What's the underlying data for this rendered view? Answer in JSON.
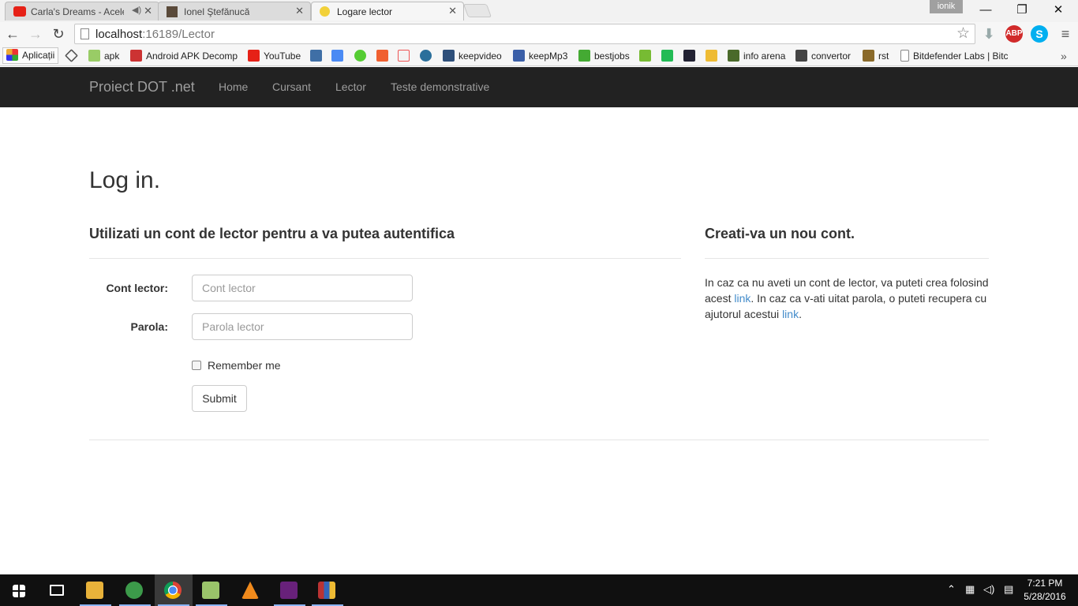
{
  "browser": {
    "tabs": [
      {
        "title": "Carla's Dreams - Acele",
        "favicon": "youtube-icon"
      },
      {
        "title": "Ionel Ştefănucă",
        "favicon": "avatar-icon"
      },
      {
        "title": "Logare lector",
        "favicon": "bulb-icon"
      }
    ],
    "user_badge": "ionik",
    "url_host": "localhost",
    "url_rest": ":16189/Lector",
    "bookmarks": [
      {
        "label": "Aplicații",
        "icon": "apps-grid-icon"
      },
      {
        "label": "",
        "icon": "diamond-icon"
      },
      {
        "label": "apk",
        "icon": "android-icon"
      },
      {
        "label": "Android APK Decomp",
        "icon": "robot-icon"
      },
      {
        "label": "YouTube",
        "icon": "youtube-icon"
      },
      {
        "label": "",
        "icon": "tz-icon"
      },
      {
        "label": "",
        "icon": "translate-icon"
      },
      {
        "label": "",
        "icon": "green-ball-icon"
      },
      {
        "label": "",
        "icon": "plus-icon"
      },
      {
        "label": "",
        "icon": "eb-icon"
      },
      {
        "label": "",
        "icon": "blue-drop-icon"
      },
      {
        "label": "keepvideo",
        "icon": "kv-icon"
      },
      {
        "label": "keepMp3",
        "icon": "mp3-icon"
      },
      {
        "label": "bestjobs",
        "icon": "star-green-icon"
      },
      {
        "label": "",
        "icon": "android-green-icon"
      },
      {
        "label": "",
        "icon": "u-icon"
      },
      {
        "label": "",
        "icon": "mt-icon"
      },
      {
        "label": "",
        "icon": "star-yellow-icon"
      },
      {
        "label": "info arena",
        "icon": "dino-icon"
      },
      {
        "label": "convertor",
        "icon": "binary-icon"
      },
      {
        "label": "rst",
        "icon": "rst-icon"
      },
      {
        "label": "Bitdefender Labs | Bitc",
        "icon": "page-icon"
      }
    ]
  },
  "site": {
    "brand": "Proiect DOT .net",
    "nav": [
      "Home",
      "Cursant",
      "Lector",
      "Teste demonstrative"
    ]
  },
  "login": {
    "heading": "Log in.",
    "subheading": "Utilizati un cont de lector pentru a va putea autentifica",
    "account_label": "Cont lector:",
    "account_placeholder": "Cont lector",
    "password_label": "Parola:",
    "password_placeholder": "Parola lector",
    "remember_label": "Remember me",
    "submit_label": "Submit"
  },
  "register": {
    "heading": "Creati-va un nou cont.",
    "text_1": "In caz ca nu aveti un cont de lector, va puteti crea folosind acest ",
    "link_1": "link",
    "text_2": ". In caz ca v-ati uitat parola, o puteti recupera cu ajutorul acestui ",
    "link_2": "link",
    "text_3": "."
  },
  "taskbar": {
    "time": "7:21 PM",
    "date": "5/28/2016"
  },
  "colors": {
    "navbar_bg": "#222222",
    "navbar_text": "#9d9d9d",
    "link": "#428bca",
    "taskbar_bg": "#101010"
  }
}
